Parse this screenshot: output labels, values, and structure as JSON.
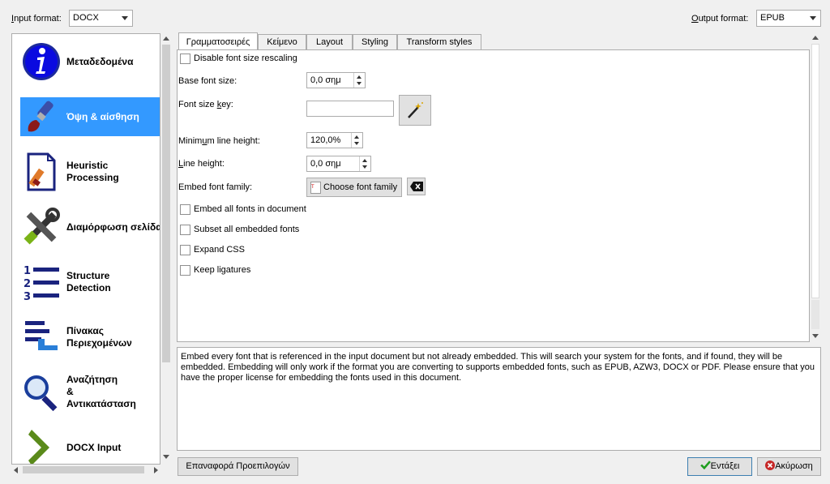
{
  "input_format": {
    "label": "Input format:",
    "value": "DOCX"
  },
  "output_format": {
    "label": "Output format:",
    "value": "EPUB"
  },
  "sidebar": {
    "items": [
      {
        "label": "Μεταδεδομένα"
      },
      {
        "label": "Όψη & αίσθηση"
      },
      {
        "label_1": "Heuristic",
        "label_2": "Processing"
      },
      {
        "label": "Διαμόρφωση σελίδας"
      },
      {
        "label_1": "Structure",
        "label_2": "Detection"
      },
      {
        "label_1": "Πίνακας",
        "label_2": "Περιεχομένων"
      },
      {
        "label_1": "Αναζήτηση",
        "label_2": "&",
        "label_3": "Αντικατάσταση"
      },
      {
        "label": "DOCX Input"
      }
    ]
  },
  "tabs": [
    "Γραμματοσειρές",
    "Κείμενο",
    "Layout",
    "Styling",
    "Transform styles"
  ],
  "form": {
    "disable_font_rescaling": "Disable font size rescaling",
    "base_font_size_label": "Base font size:",
    "base_font_size_value": "0,0 σημ",
    "font_size_key_label": "Font size key:",
    "font_size_key_value": "",
    "min_line_height_label": "Minimum line height:",
    "min_line_height_value": "120,0%",
    "line_height_label": "Line height:",
    "line_height_value": "0,0 σημ",
    "embed_font_family_label": "Embed font family:",
    "choose_font_family": "Choose font family",
    "embed_all_fonts": "Embed all fonts in document",
    "subset_fonts": "Subset all embedded fonts",
    "expand_css": "Expand CSS",
    "keep_ligatures": "Keep ligatures"
  },
  "description": "Embed every font that is referenced in the input document but not already embedded. This will search your system for the fonts, and if found, they will be embedded. Embedding will only work if the format you are converting to supports embedded fonts, such as EPUB, AZW3, DOCX or PDF. Please ensure that you have the proper license for embedding the fonts used in this document.",
  "footer": {
    "restore_defaults": "Επαναφορά Προεπιλογών",
    "ok": "Εντάξει",
    "cancel": "Ακύρωση"
  },
  "colors": {
    "selection": "#3399ff",
    "accent_blue": "#1a237e"
  }
}
